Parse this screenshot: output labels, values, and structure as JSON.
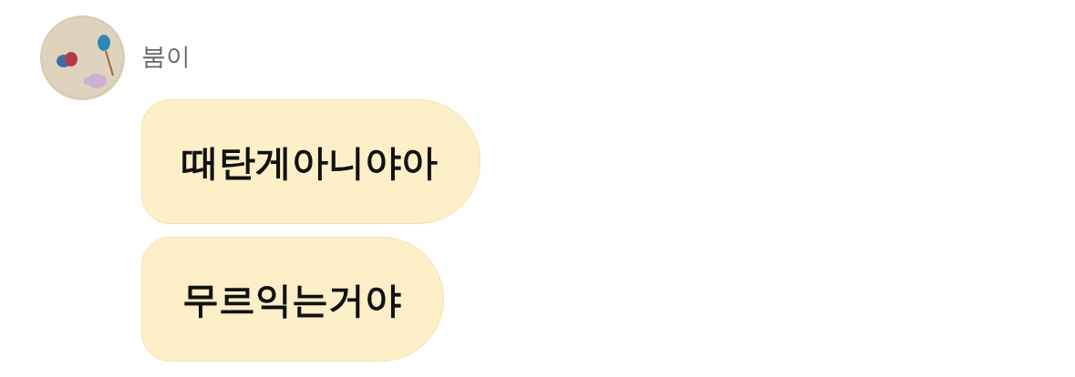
{
  "sender": {
    "name": "붐이"
  },
  "messages": [
    {
      "text": "때탄게아니야아"
    },
    {
      "text": "무르익는거야"
    }
  ]
}
